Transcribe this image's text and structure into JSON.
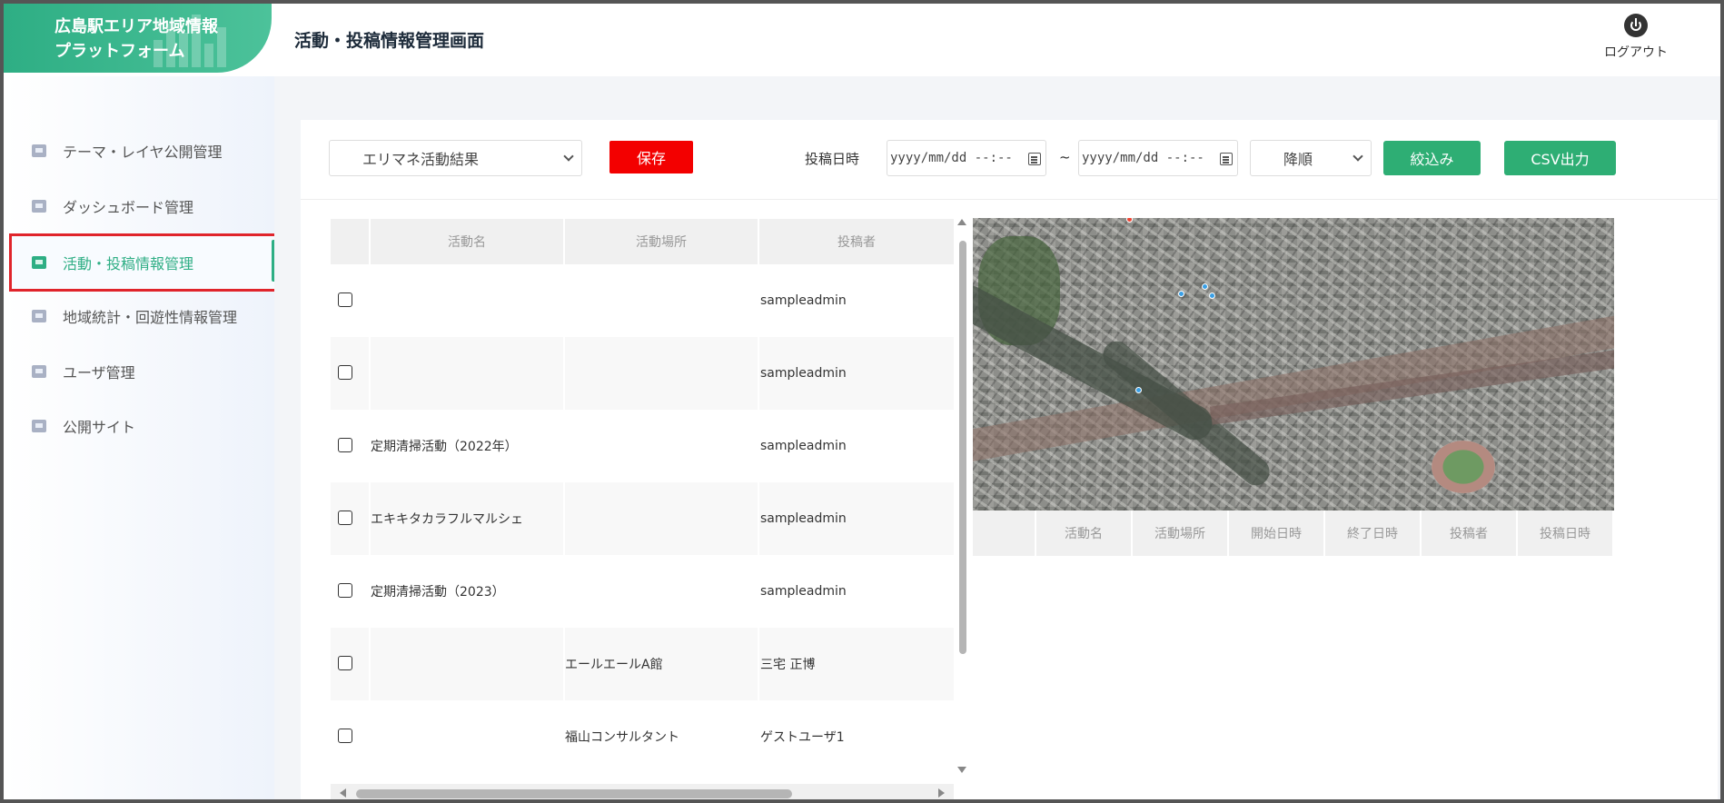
{
  "header": {
    "brand_line1": "広島駅エリア地域情報",
    "brand_line2": "プラットフォーム",
    "page_title": "活動・投稿情報管理画面",
    "logout_label": "ログアウト"
  },
  "sidebar": {
    "items": [
      {
        "label": "テーマ・レイヤ公開管理",
        "icon": "layer-icon",
        "active": false
      },
      {
        "label": "ダッシュボード管理",
        "icon": "dashboard-icon",
        "active": false
      },
      {
        "label": "活動・投稿情報管理",
        "icon": "post-icon",
        "active": true
      },
      {
        "label": "地域統計・回遊性情報管理",
        "icon": "stats-icon",
        "active": false
      },
      {
        "label": "ユーザ管理",
        "icon": "user-icon",
        "active": false
      },
      {
        "label": "公開サイト",
        "icon": "site-icon",
        "active": false
      }
    ]
  },
  "toolbar": {
    "category_select": "エリマネ活動結果",
    "save_label": "保存",
    "date_label": "投稿日時",
    "date_from": "yyyy/mm/dd --:--",
    "date_to": "yyyy/mm/dd --:--",
    "tilde": "~",
    "order_select": "降順",
    "filter_label": "絞込み",
    "csv_label": "CSV出力"
  },
  "left_table": {
    "columns": [
      "活動名",
      "活動場所",
      "投稿者"
    ],
    "rows": [
      {
        "name": "",
        "place": "",
        "poster": "sampleadmin"
      },
      {
        "name": "",
        "place": "",
        "poster": "sampleadmin"
      },
      {
        "name": "定期清掃活動（2022年）",
        "place": "",
        "poster": "sampleadmin"
      },
      {
        "name": "エキキタカラフルマルシェ",
        "place": "",
        "poster": "sampleadmin"
      },
      {
        "name": "定期清掃活動（2023）",
        "place": "",
        "poster": "sampleadmin"
      },
      {
        "name": "",
        "place": "エールエールA館",
        "poster": "三宅 正博"
      },
      {
        "name": "",
        "place": "福山コンサルタント",
        "poster": "ゲストユーザ1"
      }
    ]
  },
  "right_table": {
    "columns": [
      "活動名",
      "活動場所",
      "開始日時",
      "終了日時",
      "投稿者",
      "投稿日時"
    ]
  },
  "colors": {
    "brand_green": "#2eae84",
    "save_red": "#f30000",
    "active_outline": "#e0242b"
  }
}
